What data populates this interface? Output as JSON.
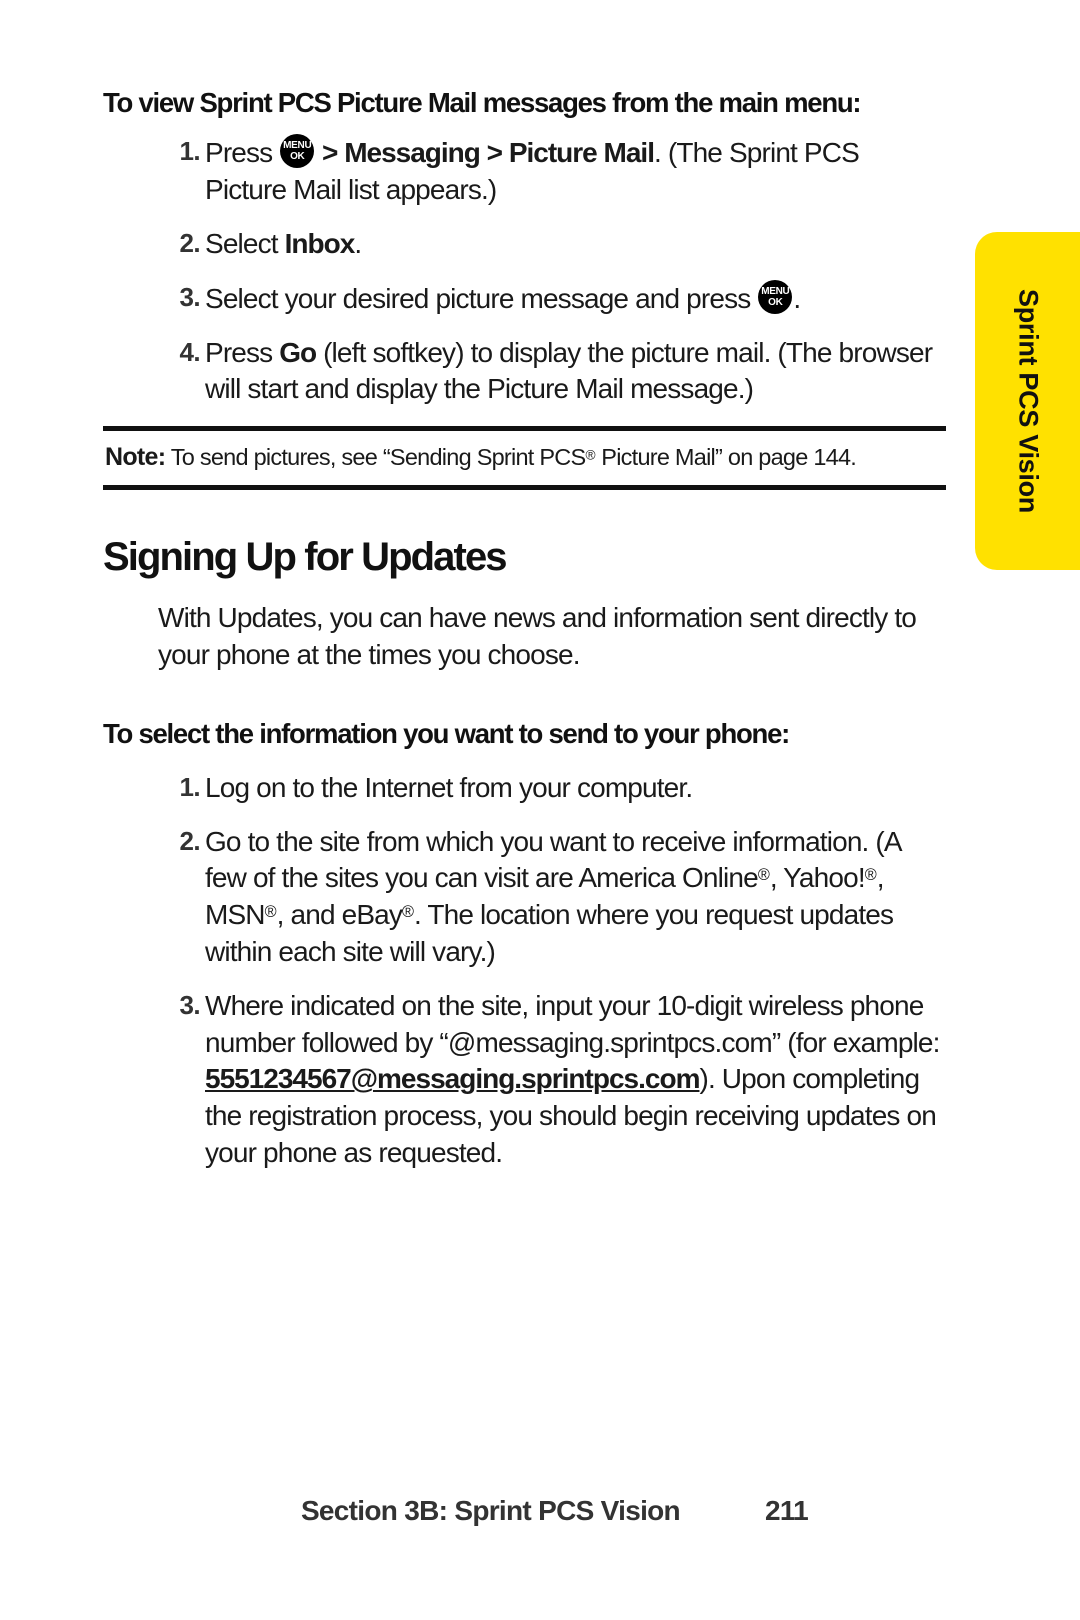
{
  "side_tab": {
    "label": "Sprint PCS Vision",
    "background_color": "#FFE100",
    "text_color": "#111111"
  },
  "procedure_1": {
    "heading": "To view Sprint PCS Picture Mail messages from the main menu:",
    "steps": [
      {
        "number": "1.",
        "text_before_key": "Press ",
        "key_icon": "menu-ok-key-icon",
        "key_top": "MENU",
        "key_bottom": "OK",
        "nav_sep_1": " > ",
        "bold_1": "Messaging",
        "nav_sep_2": " > ",
        "bold_2": "Picture Mail",
        "text_after": ". (The Sprint PCS Picture Mail list appears.)"
      },
      {
        "number": "2.",
        "text_before": "Select ",
        "bold_1": "Inbox",
        "text_after": "."
      },
      {
        "number": "3.",
        "text_before": "Select your desired picture message and press ",
        "key_icon": "menu-ok-key-icon",
        "key_top": "MENU",
        "key_bottom": "OK",
        "text_after": "."
      },
      {
        "number": "4.",
        "text_before": "Press ",
        "bold_1": "Go",
        "text_after": " (left softkey) to display the picture mail. (The browser will start and display the Picture Mail message.)"
      }
    ]
  },
  "note": {
    "label": "Note:",
    "text_1": " To send pictures, see “Sending Sprint PCS",
    "reg_mark": "®",
    "text_2": " Picture Mail” on page 144."
  },
  "section": {
    "heading": "Signing Up for Updates",
    "intro": "With Updates, you can have news and information sent directly to your phone at the times you choose."
  },
  "procedure_2": {
    "heading": "To select the information you want to send to your phone:",
    "steps": [
      {
        "number": "1.",
        "text": "Log on to the Internet from your computer."
      },
      {
        "number": "2.",
        "text_1": "Go to the site from which you want to receive information. (A few of the sites you can visit are America Online",
        "reg_1": "®",
        "text_2": ", Yahoo!",
        "reg_2": "®",
        "text_3": ", MSN",
        "reg_3": "®",
        "text_4": ", and eBay",
        "reg_4": "®",
        "text_5": ". The location where you request updates within each site will vary.)"
      },
      {
        "number": "3.",
        "text_1": "Where indicated on the site, input your 10-digit wireless phone number followed by “@messaging.sprintpcs.com” (for example: ",
        "email_link": "5551234567@messaging.sprintpcs.com",
        "text_2": "). Upon completing the registration process, you should begin receiving updates on your phone as requested."
      }
    ]
  },
  "footer": {
    "section_title": "Section 3B: Sprint PCS Vision",
    "page_number": "211"
  }
}
